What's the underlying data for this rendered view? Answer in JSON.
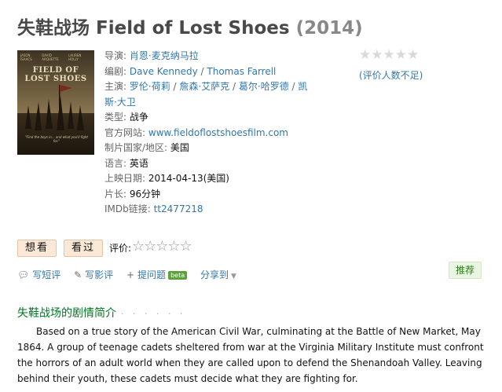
{
  "title": {
    "zh": "失鞋战场",
    "en": "Field of Lost Shoes",
    "year": "(2014)"
  },
  "poster": {
    "title_line1": "FIELD OF",
    "title_line2": "LOST SHOES",
    "names": [
      "JASON ISAACS",
      "DAVID ARQUETTE",
      "LAUREN HOLLY"
    ],
    "tagline": "\"Find the boys in... and what you'll fight for.\""
  },
  "info": {
    "director_label": "导演:",
    "director": "肖恩·麦克纳马拉",
    "writer_label": "编剧:",
    "writer1": "Dave Kennedy",
    "writer_sep": " / ",
    "writer2": "Thomas Farrell",
    "cast_label": "主演:",
    "cast1": "罗伦·荷莉",
    "cast2": "詹森·艾萨克",
    "cast3": "葛尔·哈罗德",
    "cast4a": "凯",
    "cast4b": "斯·大卫",
    "cast_sep": " / ",
    "genre_label": "类型:",
    "genre": "战争",
    "website_label": "官方网站:",
    "website": "www.fieldoflostshoesfilm.com",
    "country_label": "制片国家/地区:",
    "country": "美国",
    "language_label": "语言:",
    "language": "英语",
    "release_label": "上映日期:",
    "release": "2014-04-13(美国)",
    "runtime_label": "片长:",
    "runtime": "96分钟",
    "imdb_label": "IMDb链接:",
    "imdb": "tt2477218"
  },
  "rating": {
    "stars": "★★★★★",
    "note": "(评价人数不足)"
  },
  "buttons": {
    "want": "想看",
    "seen": "看过"
  },
  "rate": {
    "label": "评价:",
    "stars": "☆☆☆☆☆"
  },
  "actions": {
    "write_short": "写短评",
    "write_review": "写影评",
    "ask": "提问题",
    "beta": "beta",
    "share": "分享到",
    "recommend": "推荐"
  },
  "section": {
    "heading": "失鞋战场的剧情简介",
    "dots": "· · · · · ·"
  },
  "summary": "Based on a true story of the American Civil War, culminating at the Battle of New Market, May 1864. A group of teenage cadets sheltered from war at the Virginia Military Institute must confront the horrors of an adult world when they are called upon to defend the Shenandoah Valley. Leaving behind their youth, these cadets must decide what they are fighting for.",
  "colors": {
    "link": "#3377aa",
    "section": "#007722",
    "button_bg": "#fbe8d6"
  }
}
